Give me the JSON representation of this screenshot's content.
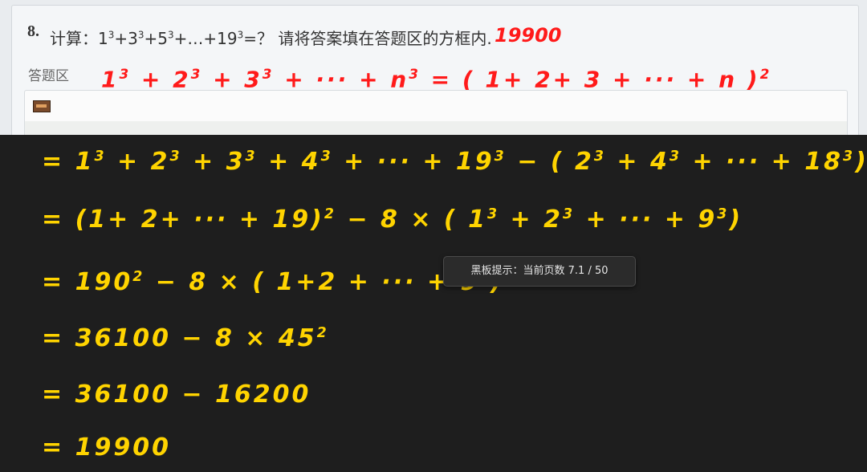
{
  "question": {
    "number": "8.",
    "prefix": "计算：1",
    "p1": "3",
    "t1": "+3",
    "p2": "3",
    "t2": "+5",
    "p3": "3",
    "t3": "+…+19",
    "p4": "3",
    "t4": "=？ 请将答案填在答题区的方框内.",
    "answer_ink": "19900"
  },
  "answer_area": {
    "label": "答题区",
    "icon": "image-icon"
  },
  "formula_ink": {
    "a": "1",
    "b": "+ 2",
    "c": "+ 3",
    "d": "+ ··· + n",
    "e": " = ( 1+ 2+ 3 + ··· + n )",
    "exp3": "3",
    "exp2": "2"
  },
  "blackboard": {
    "line1": {
      "s1": "= 1",
      "s2": "+ 2",
      "s3": "+ 3",
      "s4": "+ 4",
      "s5": "+ ··· + 19",
      "s6": " − ( 2",
      "s7": "+ 4",
      "s8": "+ ··· + 18",
      "s9": ")",
      "exp": "3"
    },
    "line2": {
      "s1": "= (1+ 2+ ··· + 19)",
      "s2": " − 8 × ( 1",
      "s3": "+ 2",
      "s4": "+ ··· + 9",
      "s5": ")",
      "exp2": "2",
      "exp3": "3"
    },
    "line3": {
      "s1": "= 190",
      "s2": " − 8 × ( 1+2 + ··· + 9 )",
      "exp2": "2"
    },
    "line4": {
      "s1": "= 36100 − 8 × 45",
      "exp2": "2"
    },
    "line5": "= 36100 − 16200",
    "line6": "= 19900"
  },
  "tooltip": {
    "text": "黑板提示：当前页数 7.1 / 50"
  },
  "colors": {
    "chalk": "#ffd400",
    "ink_red": "#ff1a1a",
    "board": "#1e1e1e"
  }
}
